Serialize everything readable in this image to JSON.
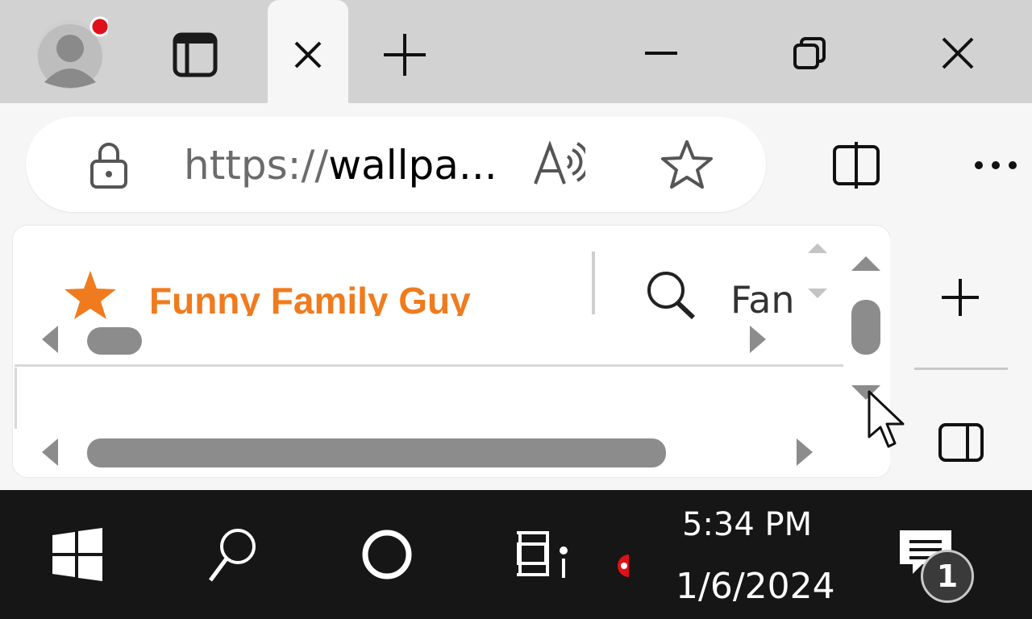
{
  "browser": {
    "address": {
      "url_scheme": "https://",
      "url_rest": "wallpa..."
    },
    "favorites": {
      "title": "Funny Family Guy",
      "search_text": "Fan"
    }
  },
  "taskbar": {
    "time": "5:34 PM",
    "date": "1/6/2024",
    "notification_count": "1"
  },
  "colors": {
    "accent_orange": "#f07b1e",
    "profile_badge": "#e0101a",
    "taskbar_bg": "#161616"
  },
  "icons": [
    "profile-icon",
    "workspaces-icon",
    "close-tab-icon",
    "new-tab-icon",
    "minimize-icon",
    "restore-icon",
    "close-window-icon",
    "lock-icon",
    "read-aloud-icon",
    "favorite-star-icon",
    "split-screen-icon",
    "more-icon",
    "star-filled-icon",
    "search-icon",
    "add-icon",
    "sidebar-toggle-icon",
    "windows-start-icon",
    "taskbar-search-icon",
    "cortana-icon",
    "task-view-icon",
    "notification-icon",
    "mouse-cursor-icon"
  ]
}
